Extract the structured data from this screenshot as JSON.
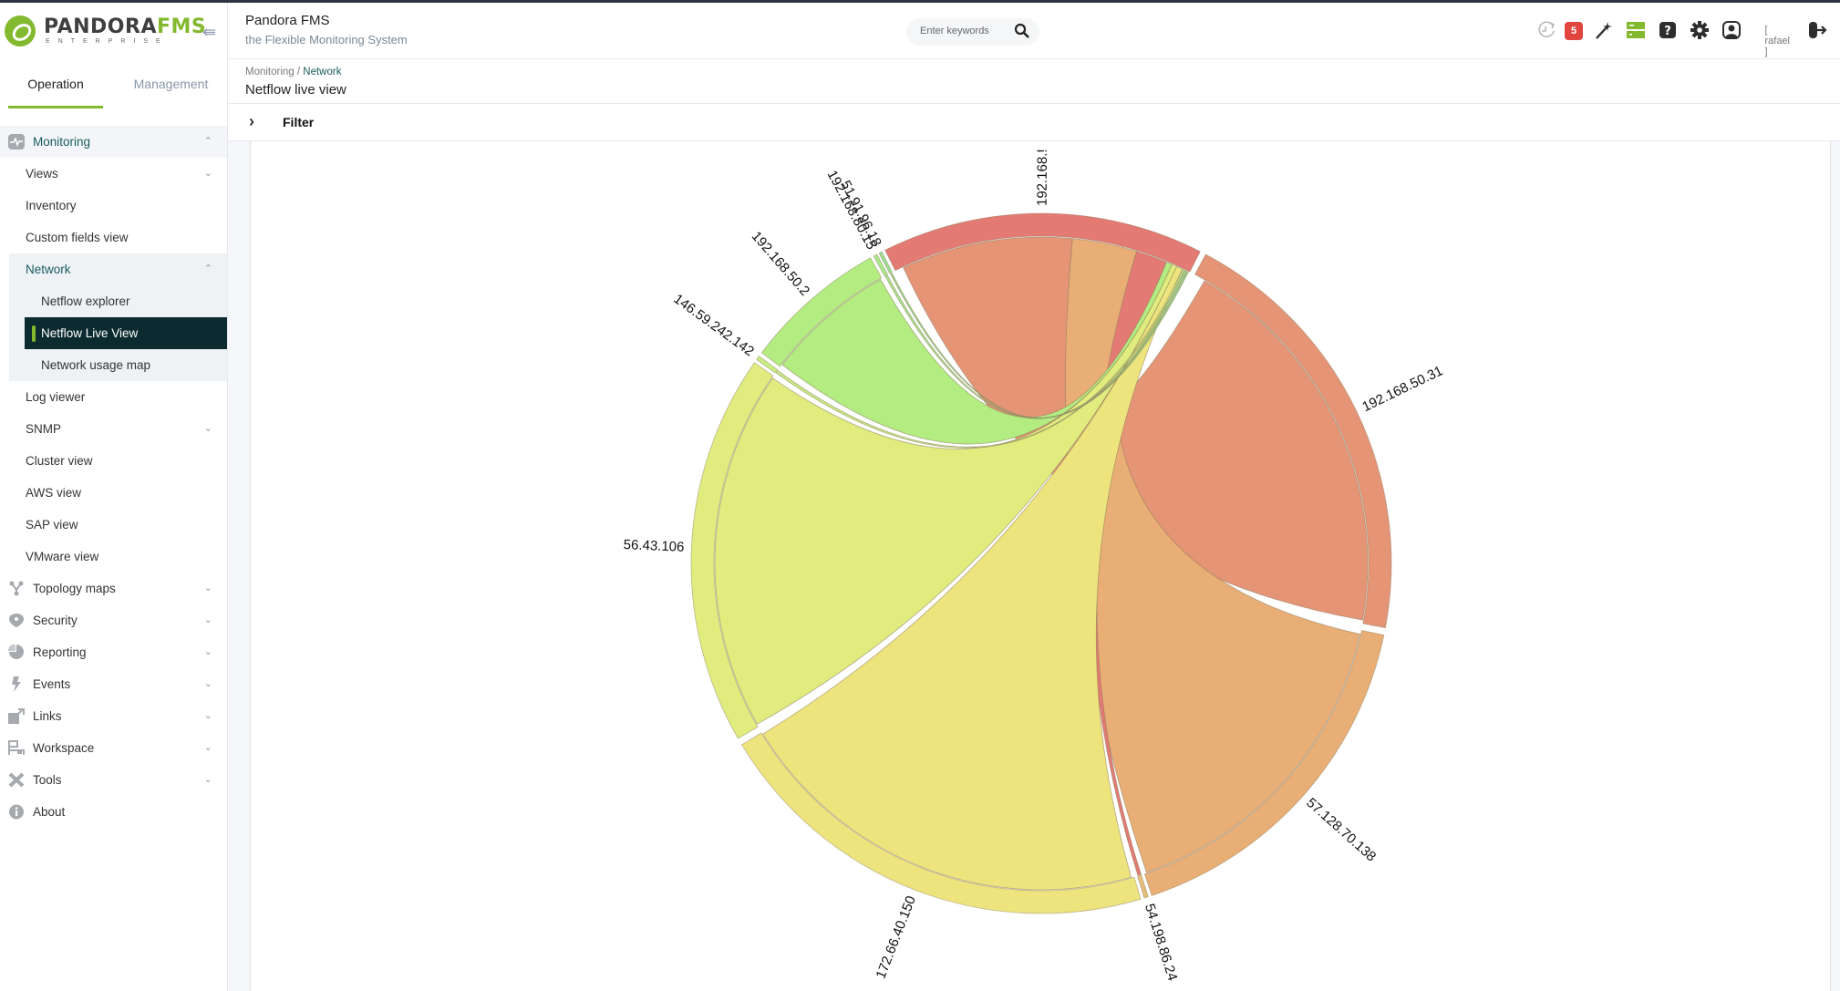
{
  "app": {
    "logo_main": "PANDORA",
    "logo_accent": "FMS",
    "logo_sub": "ENTERPRISE",
    "title": "Pandora FMS",
    "subtitle": "the Flexible Monitoring System"
  },
  "header": {
    "search_placeholder": "Enter keywords",
    "notification_count": "5",
    "username": "[ rafael ]",
    "icons": [
      "history-icon",
      "notifications-badge",
      "magic-wand-icon",
      "server-icon",
      "help-icon",
      "settings-icon",
      "user-icon",
      "logout-icon"
    ]
  },
  "sidebar": {
    "tabs": [
      {
        "label": "Operation",
        "active": true
      },
      {
        "label": "Management",
        "active": false
      }
    ],
    "monitoring": {
      "label": "Monitoring",
      "items": [
        {
          "label": "Views",
          "expandable": true
        },
        {
          "label": "Inventory"
        },
        {
          "label": "Custom fields view"
        },
        {
          "label": "Network",
          "expandable": true,
          "open": true,
          "children": [
            {
              "label": "Netflow explorer"
            },
            {
              "label": "Netflow Live View",
              "active": true
            },
            {
              "label": "Network usage map"
            }
          ]
        },
        {
          "label": "Log viewer"
        },
        {
          "label": "SNMP",
          "expandable": true
        },
        {
          "label": "Cluster view"
        },
        {
          "label": "AWS view"
        },
        {
          "label": "SAP view"
        },
        {
          "label": "VMware view"
        }
      ]
    },
    "sections": [
      {
        "label": "Topology maps",
        "icon": "topology-icon"
      },
      {
        "label": "Security",
        "icon": "shield-icon"
      },
      {
        "label": "Reporting",
        "icon": "pie-icon"
      },
      {
        "label": "Events",
        "icon": "lightning-icon"
      },
      {
        "label": "Links",
        "icon": "external-link-icon"
      },
      {
        "label": "Workspace",
        "icon": "workspace-icon"
      },
      {
        "label": "Tools",
        "icon": "tools-icon"
      },
      {
        "label": "About",
        "icon": "info-icon"
      }
    ]
  },
  "page": {
    "breadcrumb_parent": "Monitoring / ",
    "breadcrumb_current": "Network",
    "title": "Netflow live view",
    "filter_label": "Filter"
  },
  "chart_data": {
    "type": "chord",
    "title": "",
    "groups": [
      {
        "name": "192.168.!",
        "color": "#e47a74",
        "start_deg": 333.5,
        "end_deg": 27.0
      },
      {
        "name": "192.168.50.31",
        "color": "#e59476",
        "start_deg": 28.0,
        "end_deg": 100.6
      },
      {
        "name": "57.128.70.138",
        "color": "#e8ae76",
        "start_deg": 101.8,
        "end_deg": 161.6
      },
      {
        "name": "54.198.86.24",
        "color": "#e5bd7a",
        "start_deg": 162.2,
        "end_deg": 162.9
      },
      {
        "name": "172.66.40.150",
        "color": "#eee47e",
        "start_deg": 163.5,
        "end_deg": 238.8
      },
      {
        "name": "56.43.106",
        "color": "#e0ec7e",
        "start_deg": 240.0,
        "end_deg": 305.0
      },
      {
        "name": "146.59.242.142",
        "color": "#c8ec80",
        "start_deg": 305.6,
        "end_deg": 306.3
      },
      {
        "name": "192.168.50.2",
        "color": "#b3ec80",
        "start_deg": 307.0,
        "end_deg": 330.8
      },
      {
        "name": "192.168.80.15",
        "color": "#a8e888",
        "start_deg": 331.4,
        "end_deg": 332.0
      },
      {
        "name": "51.91.96.18",
        "color": "#9ce090",
        "start_deg": 332.4,
        "end_deg": 332.9
      }
    ],
    "ribbons": [
      {
        "source": "192.168.!",
        "target": "192.168.50.31",
        "src": [
          335.0,
          5.5
        ],
        "tgt": [
          30.0,
          100.0
        ],
        "color": "#e59476"
      },
      {
        "source": "192.168.!",
        "target": "57.128.70.138",
        "src": [
          5.5,
          17.0
        ],
        "tgt": [
          102.5,
          161.2
        ],
        "color": "#e8ae76"
      },
      {
        "source": "192.168.!",
        "target": "54.198.86.24",
        "src": [
          17.0,
          22.5
        ],
        "tgt": [
          162.2,
          162.8
        ],
        "color": "#e47a74"
      },
      {
        "source": "172.66.40.150",
        "target": "192.168.!",
        "src": [
          164.0,
          238.5
        ],
        "tgt": [
          24.5,
          25.6
        ],
        "color": "#eee47e"
      },
      {
        "source": "56.43.106",
        "target": "192.168.!",
        "src": [
          240.5,
          304.6
        ],
        "tgt": [
          23.6,
          24.5
        ],
        "color": "#e0ec7e"
      },
      {
        "source": "192.168.50.2",
        "target": "192.168.!",
        "src": [
          307.5,
          330.5
        ],
        "tgt": [
          22.6,
          23.6
        ],
        "color": "#b3ec80"
      },
      {
        "source": "146.59.242.142",
        "target": "192.168.!",
        "src": [
          305.7,
          306.2
        ],
        "tgt": [
          25.7,
          26.0
        ],
        "color": "#c8ec80"
      },
      {
        "source": "192.168.80.15",
        "target": "192.168.!",
        "src": [
          331.5,
          331.9
        ],
        "tgt": [
          26.1,
          26.4
        ],
        "color": "#a8e888"
      },
      {
        "source": "51.91.96.18",
        "target": "192.168.!",
        "src": [
          332.5,
          332.8
        ],
        "tgt": [
          26.5,
          26.8
        ],
        "color": "#9ce090"
      }
    ]
  }
}
